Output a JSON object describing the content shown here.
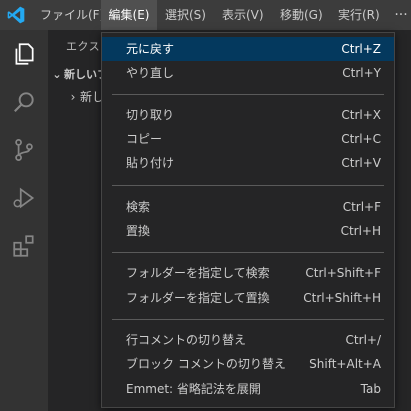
{
  "menubar": {
    "items": [
      "ファイル(F)",
      "編集(E)",
      "選択(S)",
      "表示(V)",
      "移動(G)",
      "実行(R)"
    ],
    "more": "···"
  },
  "sidebar": {
    "title": "エクスプ",
    "folder": "新しいフ",
    "subfolder": "新し"
  },
  "edit_menu": {
    "groups": [
      [
        {
          "label": "元に戻す",
          "shortcut": "Ctrl+Z"
        },
        {
          "label": "やり直し",
          "shortcut": "Ctrl+Y"
        }
      ],
      [
        {
          "label": "切り取り",
          "shortcut": "Ctrl+X"
        },
        {
          "label": "コピー",
          "shortcut": "Ctrl+C"
        },
        {
          "label": "貼り付け",
          "shortcut": "Ctrl+V"
        }
      ],
      [
        {
          "label": "検索",
          "shortcut": "Ctrl+F"
        },
        {
          "label": "置換",
          "shortcut": "Ctrl+H"
        }
      ],
      [
        {
          "label": "フォルダーを指定して検索",
          "shortcut": "Ctrl+Shift+F"
        },
        {
          "label": "フォルダーを指定して置換",
          "shortcut": "Ctrl+Shift+H"
        }
      ],
      [
        {
          "label": "行コメントの切り替え",
          "shortcut": "Ctrl+/"
        },
        {
          "label": "ブロック コメントの切り替え",
          "shortcut": "Shift+Alt+A"
        },
        {
          "label": "Emmet: 省略記法を展開",
          "shortcut": "Tab"
        }
      ]
    ]
  },
  "colors": {
    "menu_highlight": "#04395e",
    "vscode_blue": "#23a9f2"
  },
  "icons": [
    "vscode-logo-icon",
    "explorer-icon",
    "search-icon",
    "source-control-icon",
    "run-debug-icon",
    "extensions-icon"
  ]
}
